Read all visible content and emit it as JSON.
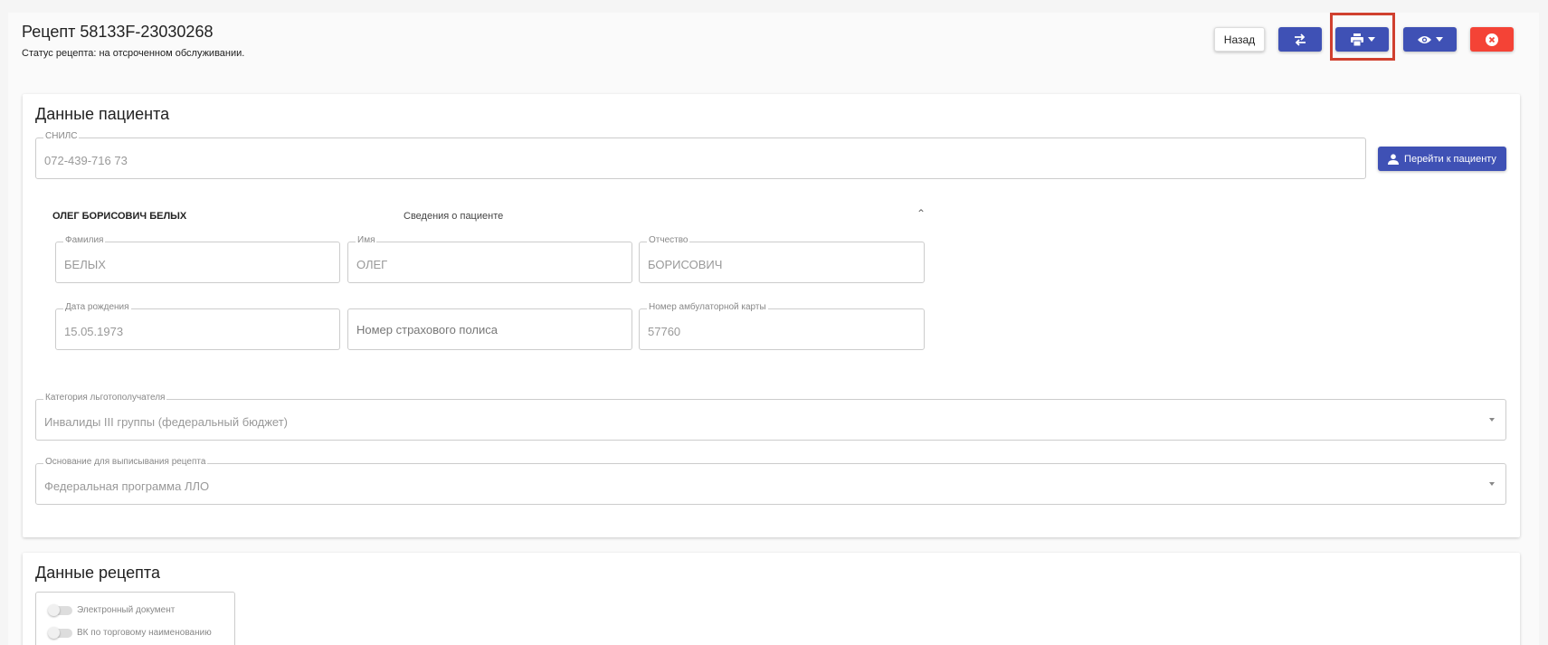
{
  "header": {
    "title": "Рецепт 58133F-23030268",
    "status": "Статус рецепта: на отсроченном обслуживании."
  },
  "toolbar": {
    "back_label": "Назад",
    "swap_icon": "swap-icon",
    "print_icon": "printer-icon",
    "view_icon": "eye-icon",
    "close_icon": "close-circle-icon"
  },
  "patient_section": {
    "title": "Данные пациента",
    "snils": {
      "label": "СНИЛС",
      "value": "072-439-716 73"
    },
    "goto_patient_label": "Перейти к пациенту",
    "name_heading": "ОЛЕГ БОРИСОВИЧ БЕЛЫХ",
    "info_heading": "Сведения о пациенте",
    "fields": {
      "last_name": {
        "label": "Фамилия",
        "value": "БЕЛЫХ"
      },
      "first_name": {
        "label": "Имя",
        "value": "ОЛЕГ"
      },
      "patronymic": {
        "label": "Отчество",
        "value": "БОРИСОВИЧ"
      },
      "birth_date": {
        "label": "Дата рождения",
        "value": "15.05.1973"
      },
      "insurance": {
        "placeholder": "Номер страхового полиса"
      },
      "card_number": {
        "label": "Номер амбулаторной карты",
        "value": "57760"
      }
    },
    "category": {
      "label": "Категория льготополучателя",
      "value": "Инвалиды III группы (федеральный бюджет)"
    },
    "basis": {
      "label": "Основание для выписывания рецепта",
      "value": "Федеральная программа ЛЛО"
    }
  },
  "recipe_section": {
    "title": "Данные рецепта",
    "toggles": [
      {
        "label": "Электронный документ"
      },
      {
        "label": "ВК по торговому наименованию"
      }
    ]
  },
  "colors": {
    "primary": "#3f51b5",
    "danger": "#f44336",
    "highlight": "#d0402f"
  }
}
